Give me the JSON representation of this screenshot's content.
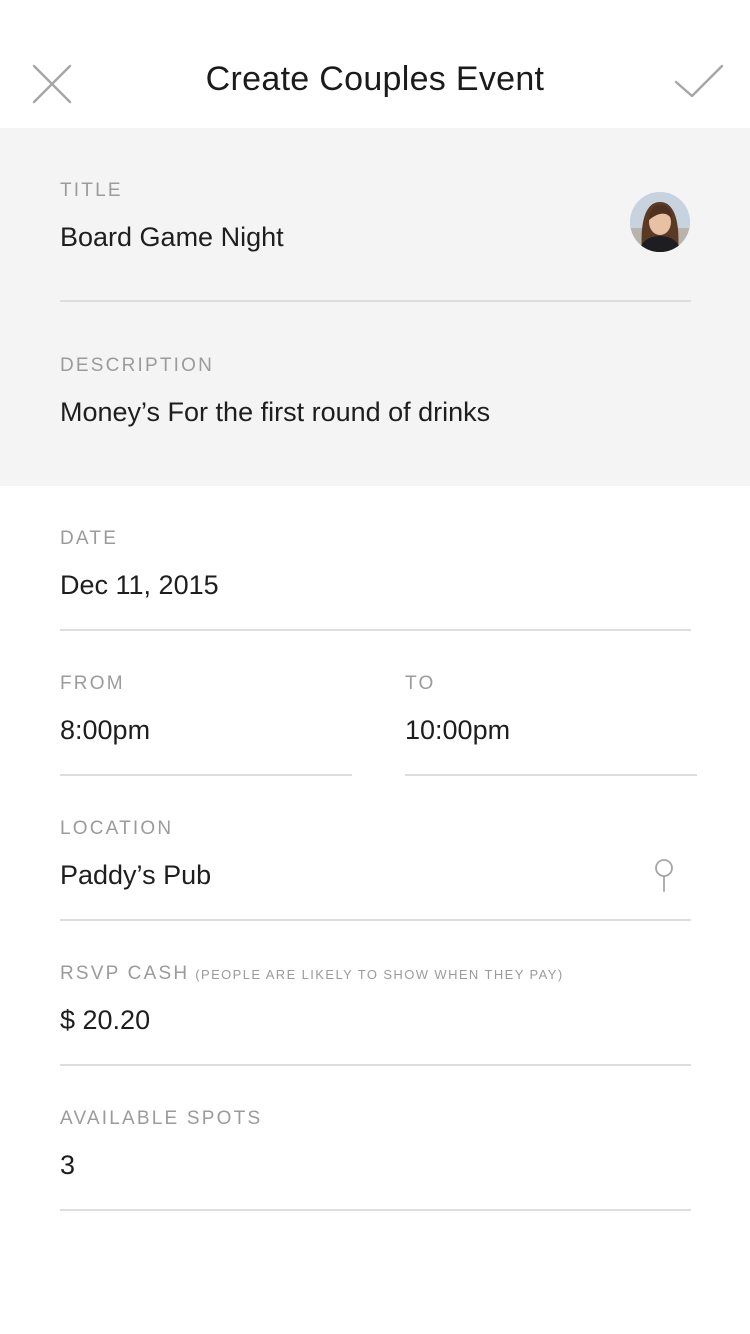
{
  "header": {
    "title": "Create Couples Event",
    "close_icon": "close-icon",
    "confirm_icon": "checkmark-icon"
  },
  "form": {
    "title": {
      "label": "TITLE",
      "value": "Board Game Night"
    },
    "description": {
      "label": "DESCRIPTION",
      "value": "Money’s For the first round of drinks"
    },
    "date": {
      "label": "DATE",
      "value": "Dec 11, 2015"
    },
    "from": {
      "label": "FROM",
      "value": "8:00pm"
    },
    "to": {
      "label": "TO",
      "value": "10:00pm"
    },
    "location": {
      "label": "LOCATION",
      "value": "Paddy’s Pub",
      "icon": "location-pin-icon"
    },
    "rsvp_cash": {
      "label": "RSVP CASH",
      "hint": "(PEOPLE ARE LIKELY TO SHOW WHEN THEY PAY)",
      "value": "$ 20.20"
    },
    "available_spots": {
      "label": "AVAILABLE SPOTS",
      "value": "3"
    }
  },
  "colors": {
    "section_gray": "#f4f4f4",
    "label_gray": "#9b9b9b",
    "divider": "#dddddd",
    "icon_gray": "#a6a6a6"
  }
}
